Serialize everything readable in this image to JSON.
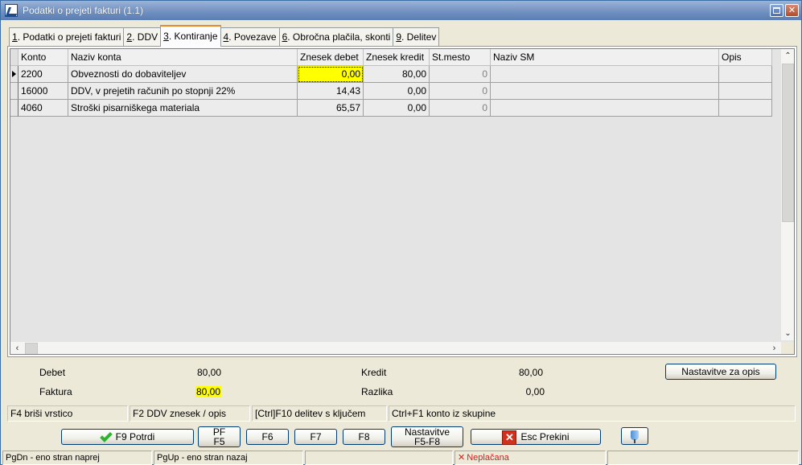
{
  "window": {
    "title": "Podatki o prejeti fakturi  (1.1)"
  },
  "tabs": [
    {
      "num": "1",
      "label": ". Podatki o prejeti fakturi"
    },
    {
      "num": "2",
      "label": ". DDV"
    },
    {
      "num": "3",
      "label": ". Kontiranje"
    },
    {
      "num": "4",
      "label": ". Povezave"
    },
    {
      "num": "6",
      "label": ". Obročna plačila, skonti"
    },
    {
      "num": "9",
      "label": ". Delitev"
    }
  ],
  "grid": {
    "columns": [
      "Konto",
      "Naziv konta",
      "Znesek debet",
      "Znesek kredit",
      "St.mesto",
      "Naziv SM",
      "Opis"
    ],
    "rows": [
      {
        "konto": "2200",
        "naziv": "Obveznosti do dobaviteljev",
        "debet": "0,00",
        "kredit": "80,00",
        "stmesto": "0",
        "nazivsm": "",
        "opis": ""
      },
      {
        "konto": "16000",
        "naziv": "DDV, v prejetih računih po stopnji 22%",
        "debet": "14,43",
        "kredit": "0,00",
        "stmesto": "0",
        "nazivsm": "",
        "opis": ""
      },
      {
        "konto": "4060",
        "naziv": "Stroški pisarniškega materiala",
        "debet": "65,57",
        "kredit": "0,00",
        "stmesto": "0",
        "nazivsm": "",
        "opis": ""
      }
    ]
  },
  "summary": {
    "debet_label": "Debet",
    "debet_value": "80,00",
    "kredit_label": "Kredit",
    "kredit_value": "80,00",
    "faktura_label": "Faktura",
    "faktura_value": "80,00",
    "razlika_label": "Razlika",
    "razlika_value": "0,00",
    "settings_button": "Nastavitve za opis"
  },
  "hints": [
    "F4 briši vrstico",
    "F2 DDV znesek / opis",
    "[Ctrl]F10 delitev s ključem",
    "Ctrl+F1 konto iz skupine"
  ],
  "buttons": {
    "confirm": "F9 Potrdi",
    "pf_top": "PF",
    "pf_bottom": "F5",
    "f6": "F6",
    "f7": "F7",
    "f8": "F8",
    "settings_top": "Nastavitve",
    "settings_bottom": "F5-F8",
    "cancel": "Esc Prekini"
  },
  "statusbar": [
    "PgDn - eno stran naprej",
    "PgUp - eno stran nazaj",
    "",
    "Neplačana",
    ""
  ],
  "colors": {
    "highlight": "#ffff00",
    "status_red": "#d0201c",
    "title_blue": "#6f8fbf"
  },
  "icons": {
    "confirm": "check-icon",
    "cancel": "x-icon",
    "pin": "pin-icon",
    "status": "x-icon"
  }
}
